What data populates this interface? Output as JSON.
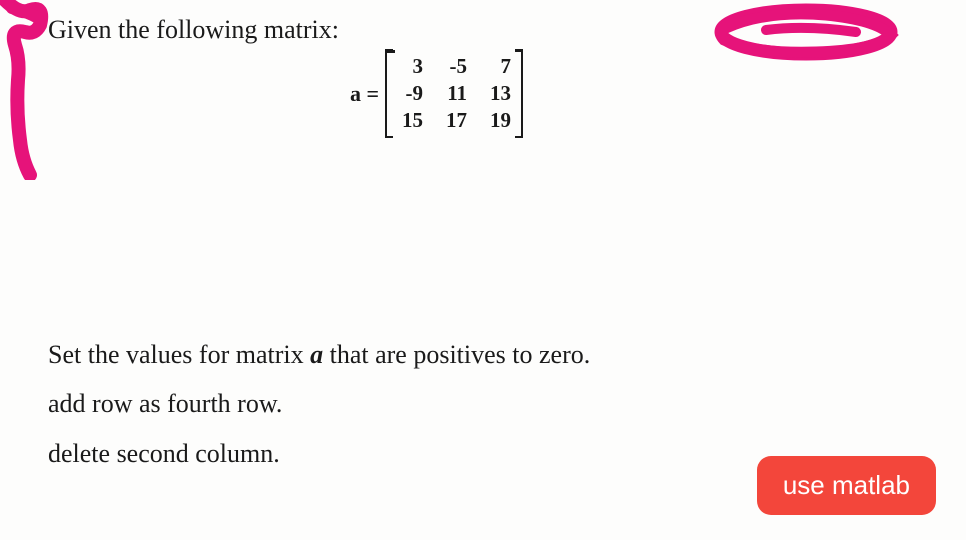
{
  "prompt": "Given the following matrix:",
  "matrix": {
    "lhs": "a =",
    "rows": [
      [
        "3",
        "-5",
        "7"
      ],
      [
        "-9",
        "11",
        "13"
      ],
      [
        "15",
        "17",
        "19"
      ]
    ]
  },
  "instructions": {
    "line1_pre": "Set the values for matrix ",
    "line1_var": "a",
    "line1_post": " that are positives to zero.",
    "line2": "add row as fourth row.",
    "line3": "delete second column."
  },
  "badge": "use matlab"
}
